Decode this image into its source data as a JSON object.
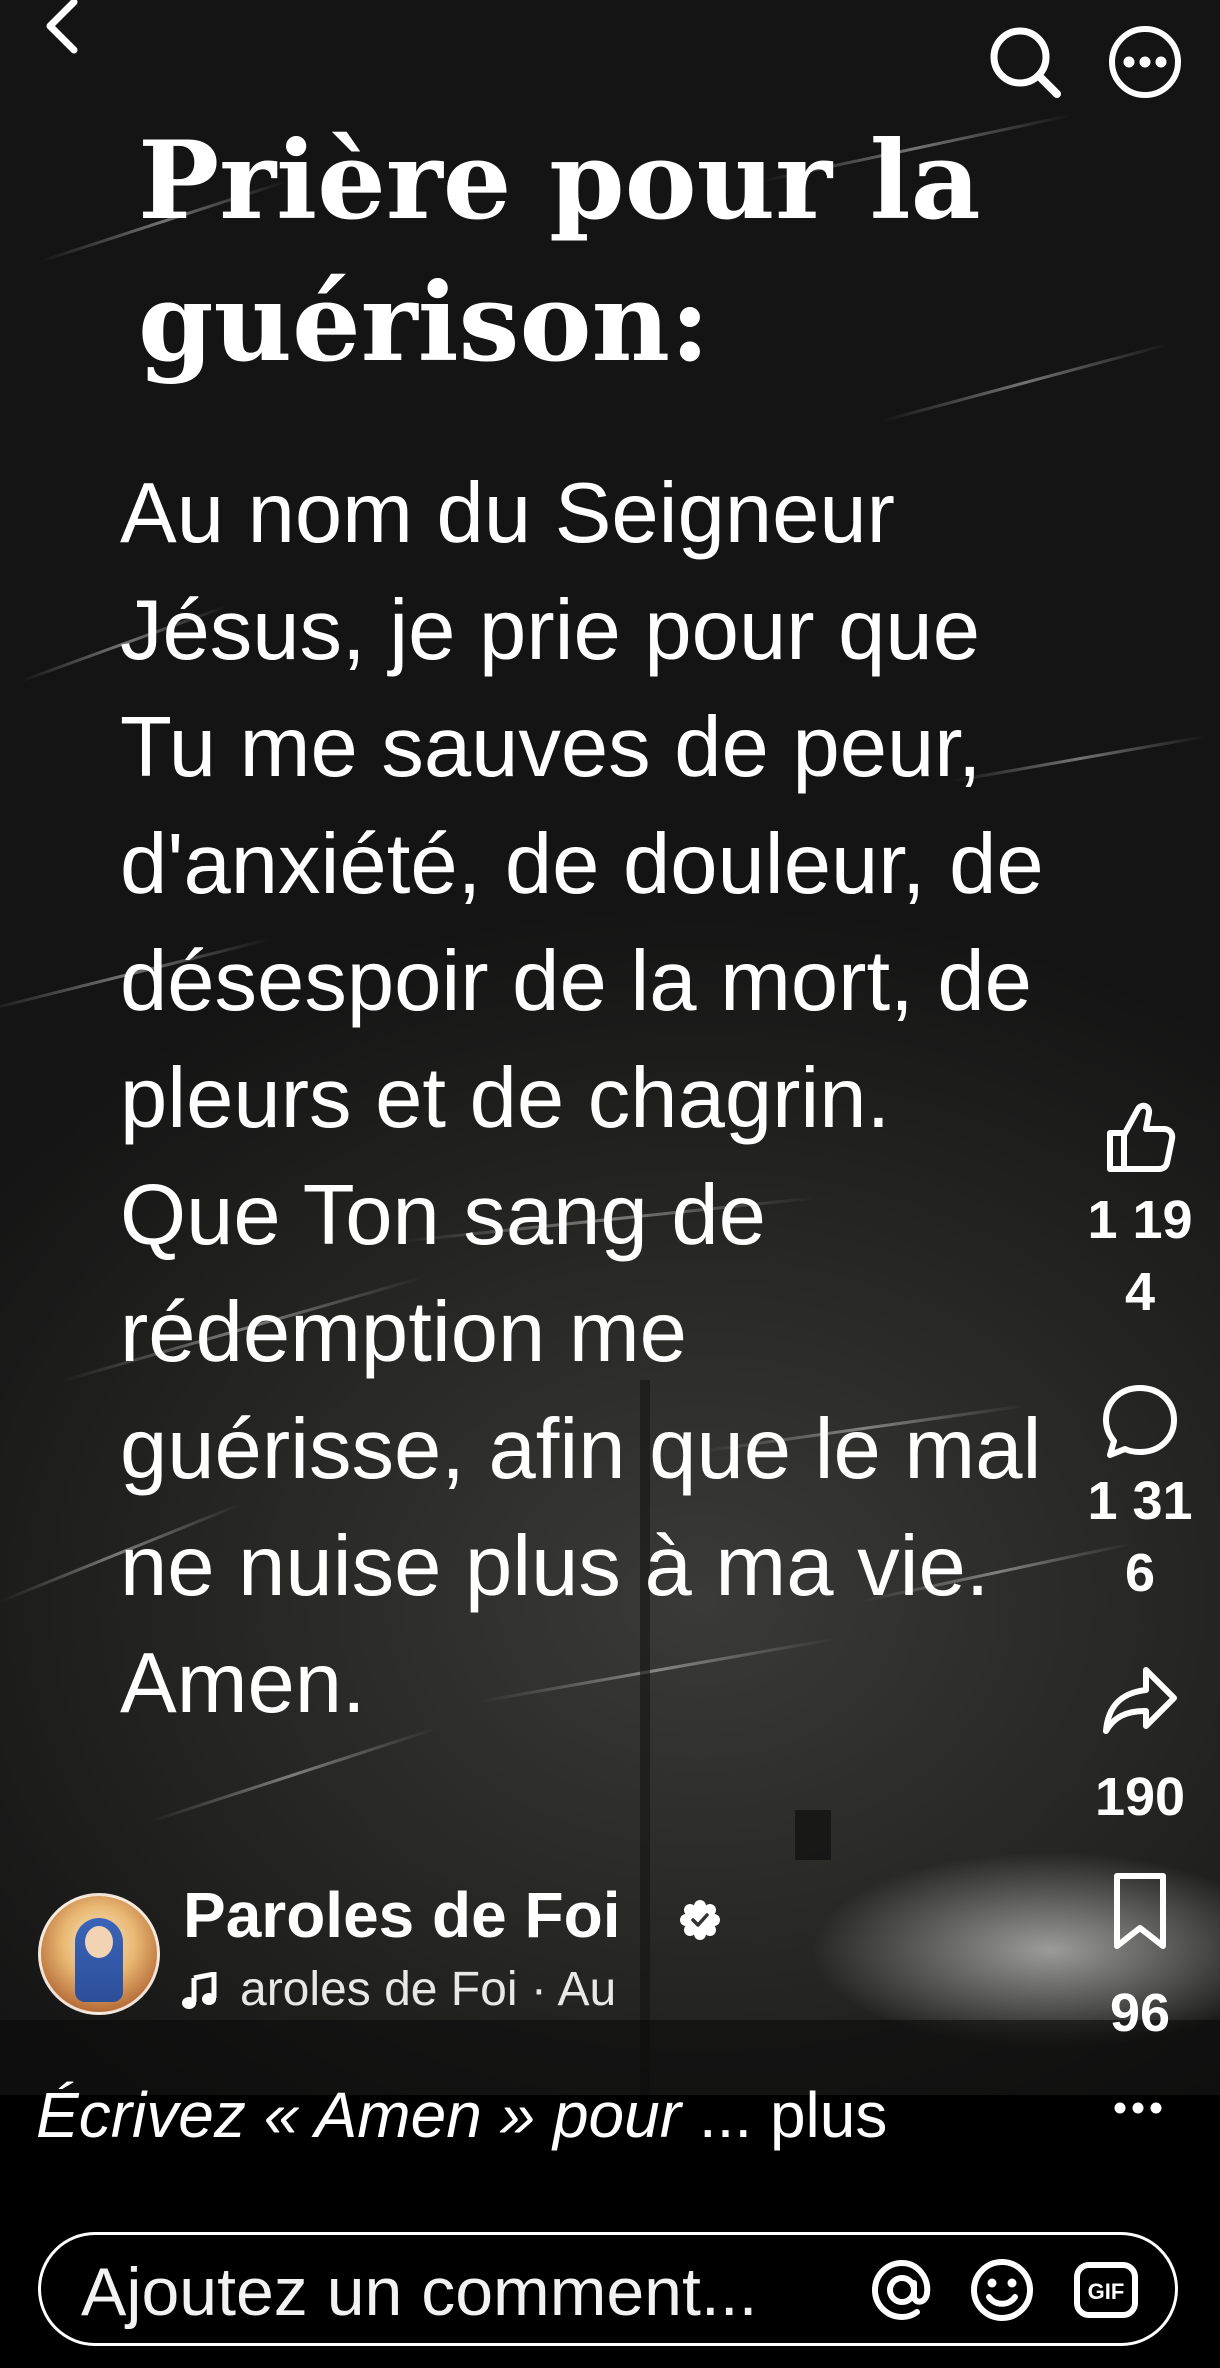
{
  "post": {
    "title": "Prière pour la guérison:",
    "title_lines": [
      "Prière pour la",
      "guérison:"
    ],
    "body_lines": [
      "Au nom du Seigneur",
      "Jésus, je prie pour que",
      "Tu me sauves de peur,",
      "d'anxiété, de douleur, de",
      "désespoir de la mort, de",
      "pleurs et de chagrin.",
      "Que Ton sang de",
      "rédemption me",
      "guérisse, afin que le mal",
      "ne nuise plus à ma vie.",
      "Amen."
    ]
  },
  "top_bar": {
    "back_icon": "chevron-left-icon",
    "search_icon": "search-icon",
    "more_icon": "more-horizontal-circle-icon"
  },
  "actions": {
    "likes": [
      "1 19",
      "4"
    ],
    "comments": [
      "1 31",
      "6"
    ],
    "shares": "190",
    "saves": "96"
  },
  "author": {
    "name": "Paroles de Foi",
    "audio": "aroles de Foi · Au"
  },
  "caption": {
    "italic_text": "Écrivez « Amen » pour",
    "suffix": " ... plus"
  },
  "comment": {
    "placeholder": "Ajoutez un comment..."
  },
  "colors": {
    "background": "#000000",
    "text": "#ffffff"
  }
}
